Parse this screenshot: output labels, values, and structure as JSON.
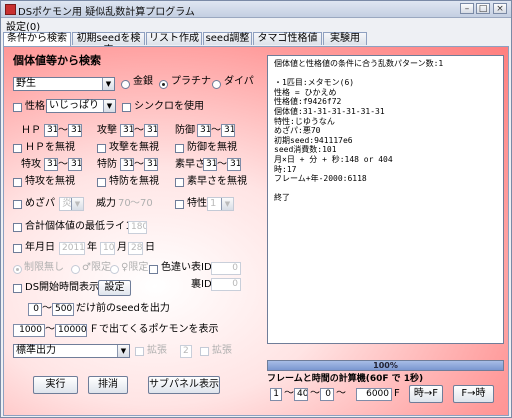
{
  "window": {
    "title": "DSポケモン用 疑似乱数計算プログラム"
  },
  "menu": {
    "settings": "設定(0)"
  },
  "tabs": [
    "条件から検索",
    "初期seedを検索",
    "リスト作成",
    "seed調整",
    "タマゴ性格値",
    "実験用"
  ],
  "form": {
    "heading": "個体値等から検索",
    "method": "野生",
    "versions": [
      "金銀",
      "プラチナ",
      "ダイパ"
    ],
    "selected_version": "プラチナ",
    "nature_label": "性格",
    "nature_value": "いじっぱり",
    "synchro_label": "シンクロを使用",
    "stats": [
      {
        "label": "ＨＰ",
        "min": "31",
        "max": "31",
        "ignore": "ＨＰを無視"
      },
      {
        "label": "攻撃",
        "min": "31",
        "max": "31",
        "ignore": "攻撃を無視"
      },
      {
        "label": "防御",
        "min": "31",
        "max": "31",
        "ignore": "防御を無視"
      },
      {
        "label": "特攻",
        "min": "31",
        "max": "31",
        "ignore": "特攻を無視"
      },
      {
        "label": "特防",
        "min": "31",
        "max": "31",
        "ignore": "特防を無視"
      },
      {
        "label": "素早さ",
        "min": "31",
        "max": "31",
        "ignore": "素早さを無視"
      }
    ],
    "range_sep": "～",
    "mezapa_label": "めざパ",
    "mezapa_type": "炎",
    "power_label": "威力",
    "power_min": "70",
    "power_max": "70",
    "ability_label": "特性",
    "ability_value": "1",
    "iv_total_label": "合計個体値の最低ライン",
    "iv_total_value": "180",
    "date_label": "年月日",
    "year": "2011",
    "year_unit": "年",
    "month": "10",
    "month_unit": "月",
    "day": "28",
    "day_unit": "日",
    "gender_opts": [
      "制限無し",
      "♂限定",
      "♀限定"
    ],
    "shiny_label": "色違い",
    "table_id_label": "表ID",
    "table_id_value": "0",
    "ds_time_label": "DS開始時間表示",
    "settings_button": "設定",
    "back_id_label": "裏ID",
    "back_id_value": "0",
    "seed_from": "0",
    "seed_to": "500",
    "seed_suffix": "だけ前のseedを出力",
    "frame_from": "1000",
    "frame_to": "10000",
    "frame_suffix": "Ｆで出てくるポケモンを表示",
    "output_mode": "標準出力",
    "ghost_label1": "拡張",
    "ghost_value": "2",
    "ghost_label2": "拡張",
    "run_button": "実行",
    "clear_button": "排消",
    "subpanel_button": "サブパネル表示"
  },
  "output": {
    "lines": [
      "個体値と性格値の条件に合う乱数パターン数:1",
      "",
      "・1匹目:メタモン(6)",
      "性格 = ひかえめ",
      "性格値:f9426f72",
      "個体値:31-31-31-31-31-31",
      "特性:じゆうなん",
      "めざパ:悪70",
      "初期seed:941117e6",
      "seed消費数:101",
      "月×日 + 分 + 秒:148 or 404",
      "時:17",
      "フレーム+年-2000:6118",
      "",
      "終了"
    ]
  },
  "progress": {
    "value": 1.0,
    "label": "100%"
  },
  "calc": {
    "title": "フレームと時間の計算機(60F で 1秒)",
    "val1": "1",
    "val2": "40",
    "val3": "0",
    "val4": "6000",
    "unit": "F",
    "time_to_frame": "時→F",
    "frame_to_time": "F→時"
  }
}
